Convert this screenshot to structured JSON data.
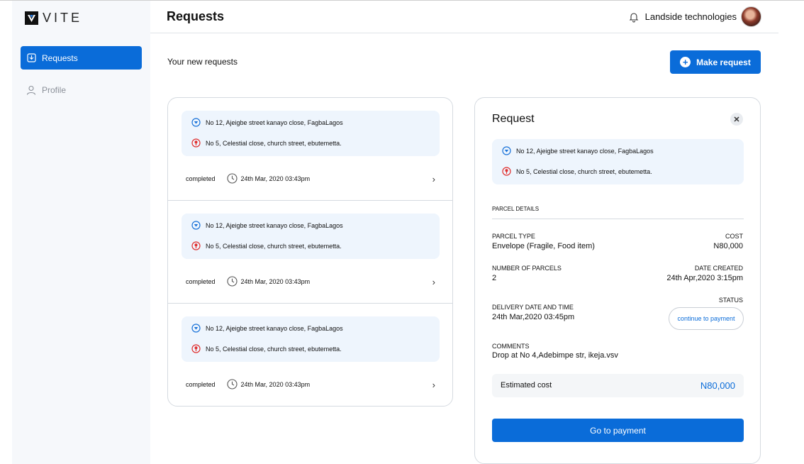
{
  "brand": {
    "name": "VITE"
  },
  "sidebar": {
    "items": [
      {
        "label": "Requests",
        "icon": "requests-icon",
        "active": true
      },
      {
        "label": "Profile",
        "icon": "profile-icon",
        "active": false
      }
    ]
  },
  "header": {
    "title": "Requests",
    "company": "Landside technologies"
  },
  "main": {
    "subheading": "Your new requests",
    "make_request_label": "Make request",
    "requests": [
      {
        "pickup": "No 12, Ajeigbe street kanayo close, FagbaLagos",
        "dropoff": "No 5, Celestial close, church street, ebutemetta.",
        "status": "completed",
        "datetime": "24th Mar, 2020 03:43pm"
      },
      {
        "pickup": "No 12, Ajeigbe street kanayo close, FagbaLagos",
        "dropoff": "No 5, Celestial close, church street, ebutemetta.",
        "status": "completed",
        "datetime": "24th Mar, 2020 03:43pm"
      },
      {
        "pickup": "No 12, Ajeigbe street kanayo close, FagbaLagos",
        "dropoff": "No 5, Celestial close, church street, ebutemetta.",
        "status": "completed",
        "datetime": "24th Mar, 2020 03:43pm"
      }
    ]
  },
  "detail": {
    "title": "Request",
    "pickup": "No 12, Ajeigbe street kanayo close, FagbaLagos",
    "dropoff": "No 5, Celestial close, church street, ebutemetta.",
    "section_label": "PARCEL DETAILS",
    "parcel_type_label": "PARCEL TYPE",
    "parcel_type": "Envelope (Fragile, Food item)",
    "cost_label": "COST",
    "cost": "N80,000",
    "num_parcels_label": "NUMBER OF PARCELS",
    "num_parcels": "2",
    "date_created_label": "DATE CREATED",
    "date_created": "24th Apr,2020 3:15pm",
    "delivery_label": "DELIVERY DATE AND TIME",
    "delivery": "24th Mar,2020 03:45pm",
    "status_label": "STATUS",
    "status": "continue to payment",
    "comments_label": "COMMENTS",
    "comments": "Drop at No 4,Adebimpe str, ikeja.vsv",
    "estimated_label": "Estimated cost",
    "estimated": "N80,000",
    "pay_label": "Go to payment"
  },
  "colors": {
    "accent": "#0a6cd9",
    "pickup_icon": "#1a73d9",
    "dropoff_icon": "#e0302f",
    "address_bg": "#eef5fd"
  }
}
